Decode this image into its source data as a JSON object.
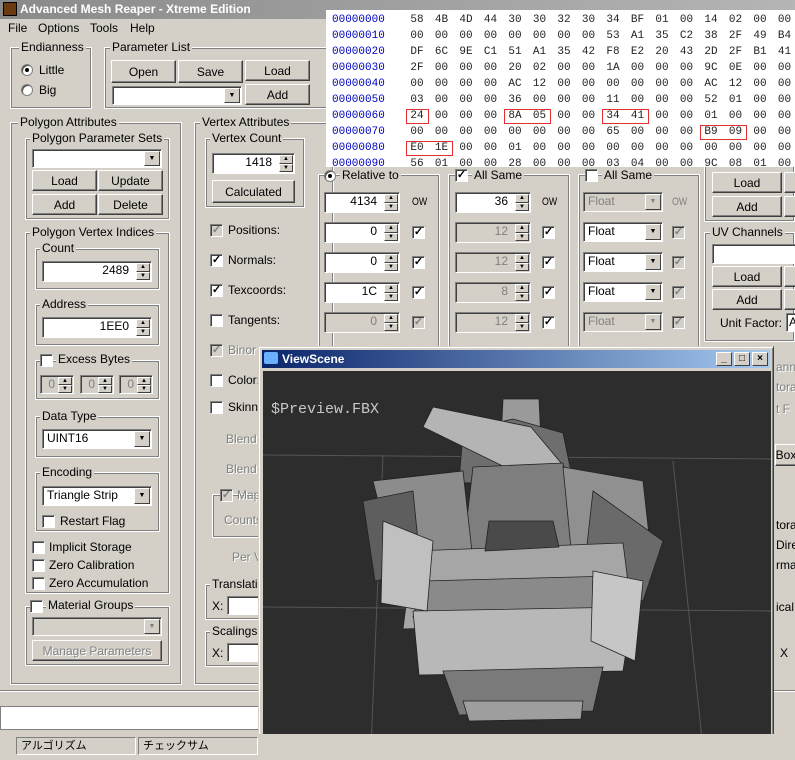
{
  "app": {
    "title": "Advanced Mesh Reaper - Xtreme Edition"
  },
  "menu": [
    "File",
    "Options",
    "Tools",
    "Help"
  ],
  "endianness": {
    "title": "Endianness",
    "options": [
      "Little",
      "Big"
    ],
    "selected": "Little"
  },
  "parameter_list": {
    "title": "Parameter List",
    "buttons": [
      "Open",
      "Save",
      "Load",
      "Add"
    ]
  },
  "polygon_attributes": {
    "title": "Polygon Attributes",
    "param_sets": {
      "title": "Polygon Parameter Sets",
      "buttons": [
        "Load",
        "Update",
        "Add",
        "Delete"
      ]
    },
    "vertex_indices": {
      "title": "Polygon Vertex Indices",
      "count": {
        "title": "Count",
        "value": "2489"
      },
      "address": {
        "title": "Address",
        "value": "1EE0"
      },
      "excess": {
        "title": "Excess Bytes",
        "values": [
          "0",
          "0",
          "0"
        ]
      },
      "data_type": {
        "title": "Data Type",
        "value": "UINT16"
      },
      "encoding": {
        "title": "Encoding",
        "value": "Triangle Strip",
        "restart_flag": "Restart Flag"
      },
      "flags": [
        "Implicit Storage",
        "Zero Calibration",
        "Zero Accumulation"
      ]
    },
    "material_groups": {
      "label": "Material Groups",
      "manage": "Manage Parameters"
    }
  },
  "vertex_attributes": {
    "title": "Vertex Attributes",
    "vertex_count": {
      "title": "Vertex Count",
      "value": "1418",
      "button": "Calculated"
    },
    "rows": [
      {
        "label": "Positions:",
        "checked": true,
        "enabled": false
      },
      {
        "label": "Normals:",
        "checked": true,
        "enabled": true
      },
      {
        "label": "Texcoords:",
        "checked": true,
        "enabled": true
      },
      {
        "label": "Tangents:",
        "checked": false,
        "enabled": true
      },
      {
        "label": "Binor",
        "checked": true,
        "enabled": false
      },
      {
        "label": "Color:",
        "checked": false,
        "enabled": true
      },
      {
        "label": "Skinn",
        "checked": false,
        "enabled": true
      }
    ],
    "blend1": "Blend",
    "blend2": "Blend",
    "map": "Map",
    "counts": "Counts",
    "per": "Per V",
    "translation": {
      "title": "Translati",
      "x": "X:"
    },
    "scalings": {
      "title": "Scalings",
      "x": "X:"
    }
  },
  "columns": {
    "relative_to": "Relative to",
    "all_same": "All Same",
    "ow": "OW",
    "col1": [
      "4134",
      "0",
      "0",
      "1C",
      "0"
    ],
    "col2": [
      "36",
      "12",
      "12",
      "8",
      "12"
    ],
    "col3": [
      "Float",
      "Float",
      "Float",
      "Float",
      "Float"
    ]
  },
  "right_panel": {
    "buttons": [
      "Load",
      "Add"
    ],
    "uv_channels": {
      "title": "UV Channels",
      "buttons": [
        "Load",
        "Add"
      ],
      "unit_factor": "Unit Factor:",
      "unit_value": "A"
    },
    "fragments": [
      "anne",
      "tora",
      "t F",
      "Box",
      "tora",
      "Dire",
      "rma",
      "ical",
      "X"
    ]
  },
  "hex": {
    "rows": [
      {
        "addr": "00000000",
        "bytes": [
          "58",
          "4B",
          "4D",
          "44",
          "30",
          "30",
          "32",
          "30",
          "34",
          "BF",
          "01",
          "00",
          "14",
          "02",
          "00",
          "00"
        ]
      },
      {
        "addr": "00000010",
        "bytes": [
          "00",
          "00",
          "00",
          "00",
          "00",
          "00",
          "00",
          "00",
          "53",
          "A1",
          "35",
          "C2",
          "38",
          "2F",
          "49",
          "B4"
        ]
      },
      {
        "addr": "00000020",
        "bytes": [
          "DF",
          "6C",
          "9E",
          "C1",
          "51",
          "A1",
          "35",
          "42",
          "F8",
          "E2",
          "20",
          "43",
          "2D",
          "2F",
          "B1",
          "41"
        ]
      },
      {
        "addr": "00000030",
        "bytes": [
          "2F",
          "00",
          "00",
          "00",
          "20",
          "02",
          "00",
          "00",
          "1A",
          "00",
          "00",
          "00",
          "9C",
          "0E",
          "00",
          "00"
        ]
      },
      {
        "addr": "00000040",
        "bytes": [
          "00",
          "00",
          "00",
          "00",
          "AC",
          "12",
          "00",
          "00",
          "00",
          "00",
          "00",
          "00",
          "AC",
          "12",
          "00",
          "00"
        ]
      },
      {
        "addr": "00000050",
        "bytes": [
          "03",
          "00",
          "00",
          "00",
          "36",
          "00",
          "00",
          "00",
          "11",
          "00",
          "00",
          "00",
          "52",
          "01",
          "00",
          "00"
        ]
      },
      {
        "addr": "00000060",
        "bytes": [
          "24",
          "00",
          "00",
          "00",
          "8A",
          "05",
          "00",
          "00",
          "34",
          "41",
          "00",
          "00",
          "01",
          "00",
          "00",
          "00"
        ]
      },
      {
        "addr": "00000070",
        "bytes": [
          "00",
          "00",
          "00",
          "00",
          "00",
          "00",
          "00",
          "00",
          "65",
          "00",
          "00",
          "00",
          "B9",
          "09",
          "00",
          "00"
        ]
      },
      {
        "addr": "00000080",
        "bytes": [
          "E0",
          "1E",
          "00",
          "00",
          "01",
          "00",
          "00",
          "00",
          "00",
          "00",
          "00",
          "00",
          "00",
          "00",
          "00",
          "00"
        ]
      },
      {
        "addr": "00000090",
        "bytes": [
          "56",
          "01",
          "00",
          "00",
          "28",
          "00",
          "00",
          "00",
          "03",
          "04",
          "00",
          "00",
          "9C",
          "08",
          "01",
          "00"
        ]
      }
    ]
  },
  "viewscene": {
    "title": "ViewScene",
    "label": "$Preview.FBX"
  },
  "status": [
    "アルゴリズム",
    "チェックサム"
  ]
}
